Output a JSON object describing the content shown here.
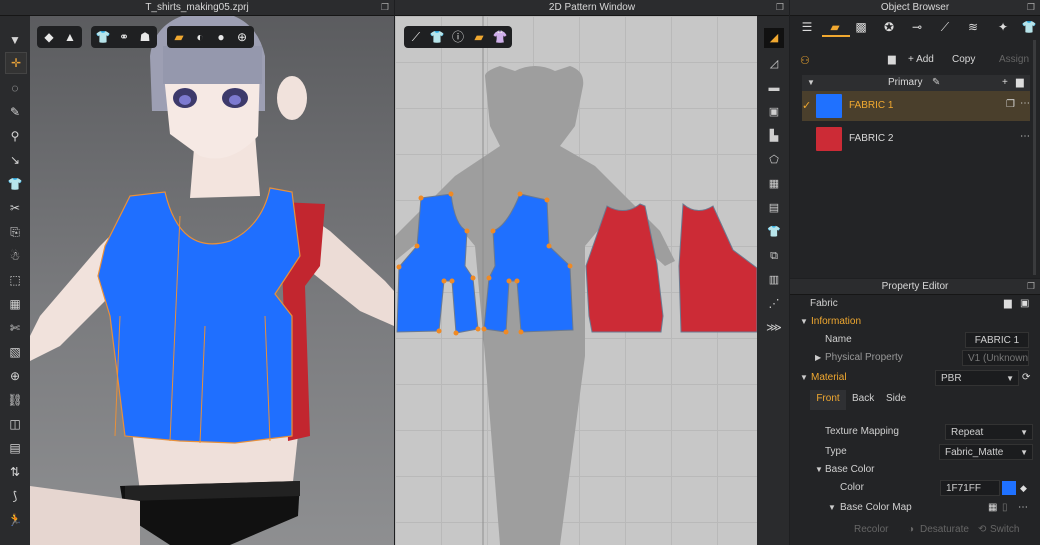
{
  "windows": {
    "three_d_title": "T_shirts_making05.zprj",
    "two_d_title": "2D Pattern Window",
    "object_browser_title": "Object Browser",
    "property_editor_title": "Property Editor"
  },
  "object_browser": {
    "actions": {
      "add": "+ Add",
      "copy": "Copy",
      "assign": "Assign"
    },
    "colorway": "Primary",
    "fabrics": [
      {
        "name": "FABRIC 1",
        "color": "#1F71FF",
        "selected": true
      },
      {
        "name": "FABRIC 2",
        "color": "#CC2B36",
        "selected": false
      }
    ]
  },
  "property_editor": {
    "object_type": "Fabric",
    "information_section": "Information",
    "name_label": "Name",
    "name_value": "FABRIC 1",
    "physical_property_label": "Physical Property",
    "physical_property_value": "V1 (Unknown",
    "material_section": "Material",
    "material_value": "PBR",
    "sides": [
      "Front",
      "Back",
      "Side"
    ],
    "texture_mapping_label": "Texture Mapping",
    "texture_mapping_value": "Repeat",
    "type_label": "Type",
    "type_value": "Fabric_Matte",
    "base_color_label": "Base Color",
    "color_label": "Color",
    "color_value": "1F71FF",
    "color_swatch": "#1F71FF",
    "base_color_map_label": "Base Color Map",
    "bottom_actions": {
      "recolor": "Recolor",
      "desaturate": "Desaturate",
      "switch": "Switch"
    }
  },
  "colors": {
    "accent": "#F0A830",
    "fabric_blue": "#1F71FF",
    "fabric_red": "#CC2B36"
  }
}
